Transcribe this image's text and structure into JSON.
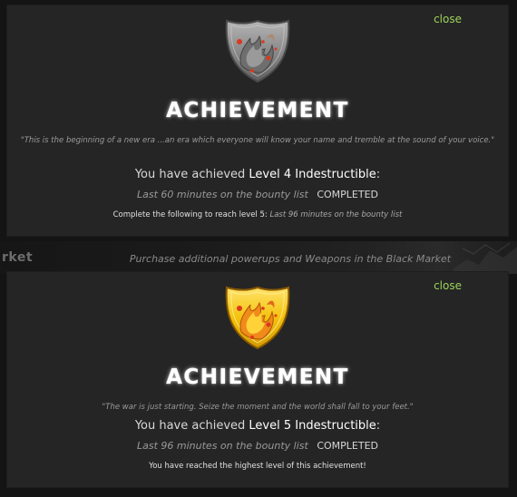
{
  "background": {
    "left_label": "rket",
    "center_text": "Purchase additional powerups and Weapons in the Black Market"
  },
  "colors": {
    "modal_bg": "#252525",
    "close_link": "#9cd35a",
    "title": "#ffffff",
    "shield_silver": "#8f8f8f",
    "shield_gold": "#f4c20d",
    "flame_red": "#d83a1e"
  },
  "modals": [
    {
      "close_label": "close",
      "icon": "silver-shield-icon",
      "title": "ACHIEVEMENT",
      "quote": "\"This is the beginning of a new era ...an era which everyone will know your name and tremble at the sound of your voice.\"",
      "achieved_prefix": "You have achieved ",
      "achieved_level": "Level 4 Indestructible",
      "achieved_suffix": ":",
      "completed_task": "Last 60 minutes on the bounty list",
      "completed_status": "COMPLETED",
      "next_prefix": "Complete the following to reach level 5: ",
      "next_task": "Last 96 minutes on the bounty list"
    },
    {
      "close_label": "close",
      "icon": "gold-shield-icon",
      "title": "ACHIEVEMENT",
      "quote": "\"The war is just starting. Seize the moment and the world shall fall to your feet.\"",
      "achieved_prefix": "You have achieved ",
      "achieved_level": "Level 5 Indestructible",
      "achieved_suffix": ":",
      "completed_task": "Last 96 minutes on the bounty list",
      "completed_status": "COMPLETED",
      "final_message": "You have reached the highest level of this achievement!"
    }
  ]
}
